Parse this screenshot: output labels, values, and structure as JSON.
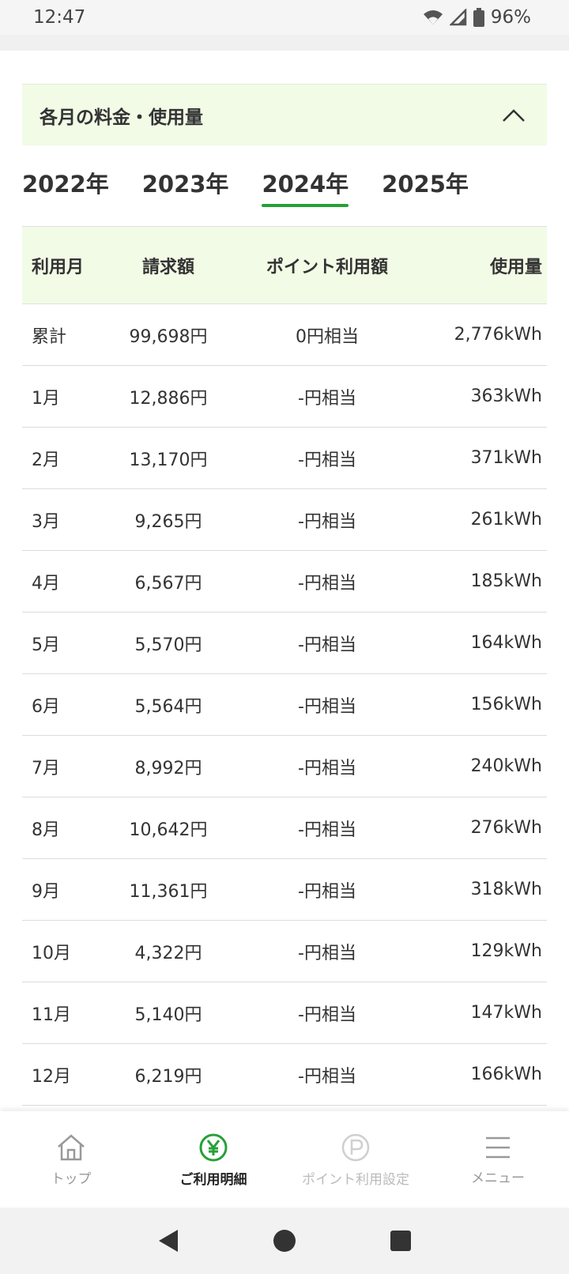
{
  "status_bar": {
    "time": "12:47",
    "battery": "96%"
  },
  "section": {
    "title": "各月の料金・使用量"
  },
  "year_tabs": [
    {
      "label": "2022年"
    },
    {
      "label": "2023年"
    },
    {
      "label": "2024年"
    },
    {
      "label": "2025年"
    }
  ],
  "active_year_index": 2,
  "table": {
    "headers": [
      "利用月",
      "請求額",
      "ポイント利用額",
      "使用量"
    ],
    "rows": [
      [
        "累計",
        "99,698円",
        "0円相当",
        "2,776kWh"
      ],
      [
        "1月",
        "12,886円",
        "-円相当",
        "363kWh"
      ],
      [
        "2月",
        "13,170円",
        "-円相当",
        "371kWh"
      ],
      [
        "3月",
        "9,265円",
        "-円相当",
        "261kWh"
      ],
      [
        "4月",
        "6,567円",
        "-円相当",
        "185kWh"
      ],
      [
        "5月",
        "5,570円",
        "-円相当",
        "164kWh"
      ],
      [
        "6月",
        "5,564円",
        "-円相当",
        "156kWh"
      ],
      [
        "7月",
        "8,992円",
        "-円相当",
        "240kWh"
      ],
      [
        "8月",
        "10,642円",
        "-円相当",
        "276kWh"
      ],
      [
        "9月",
        "11,361円",
        "-円相当",
        "318kWh"
      ],
      [
        "10月",
        "4,322円",
        "-円相当",
        "129kWh"
      ],
      [
        "11月",
        "5,140円",
        "-円相当",
        "147kWh"
      ],
      [
        "12月",
        "6,219円",
        "-円相当",
        "166kWh"
      ]
    ]
  },
  "bottom_nav": [
    {
      "label": "トップ",
      "icon": "home-icon"
    },
    {
      "label": "ご利用明細",
      "icon": "yen-icon"
    },
    {
      "label": "ポイント利用設定",
      "icon": "point-icon"
    },
    {
      "label": "メニュー",
      "icon": "menu-icon"
    }
  ],
  "colors": {
    "accent": "#26a038",
    "header_bg": "#f1fbe6"
  }
}
